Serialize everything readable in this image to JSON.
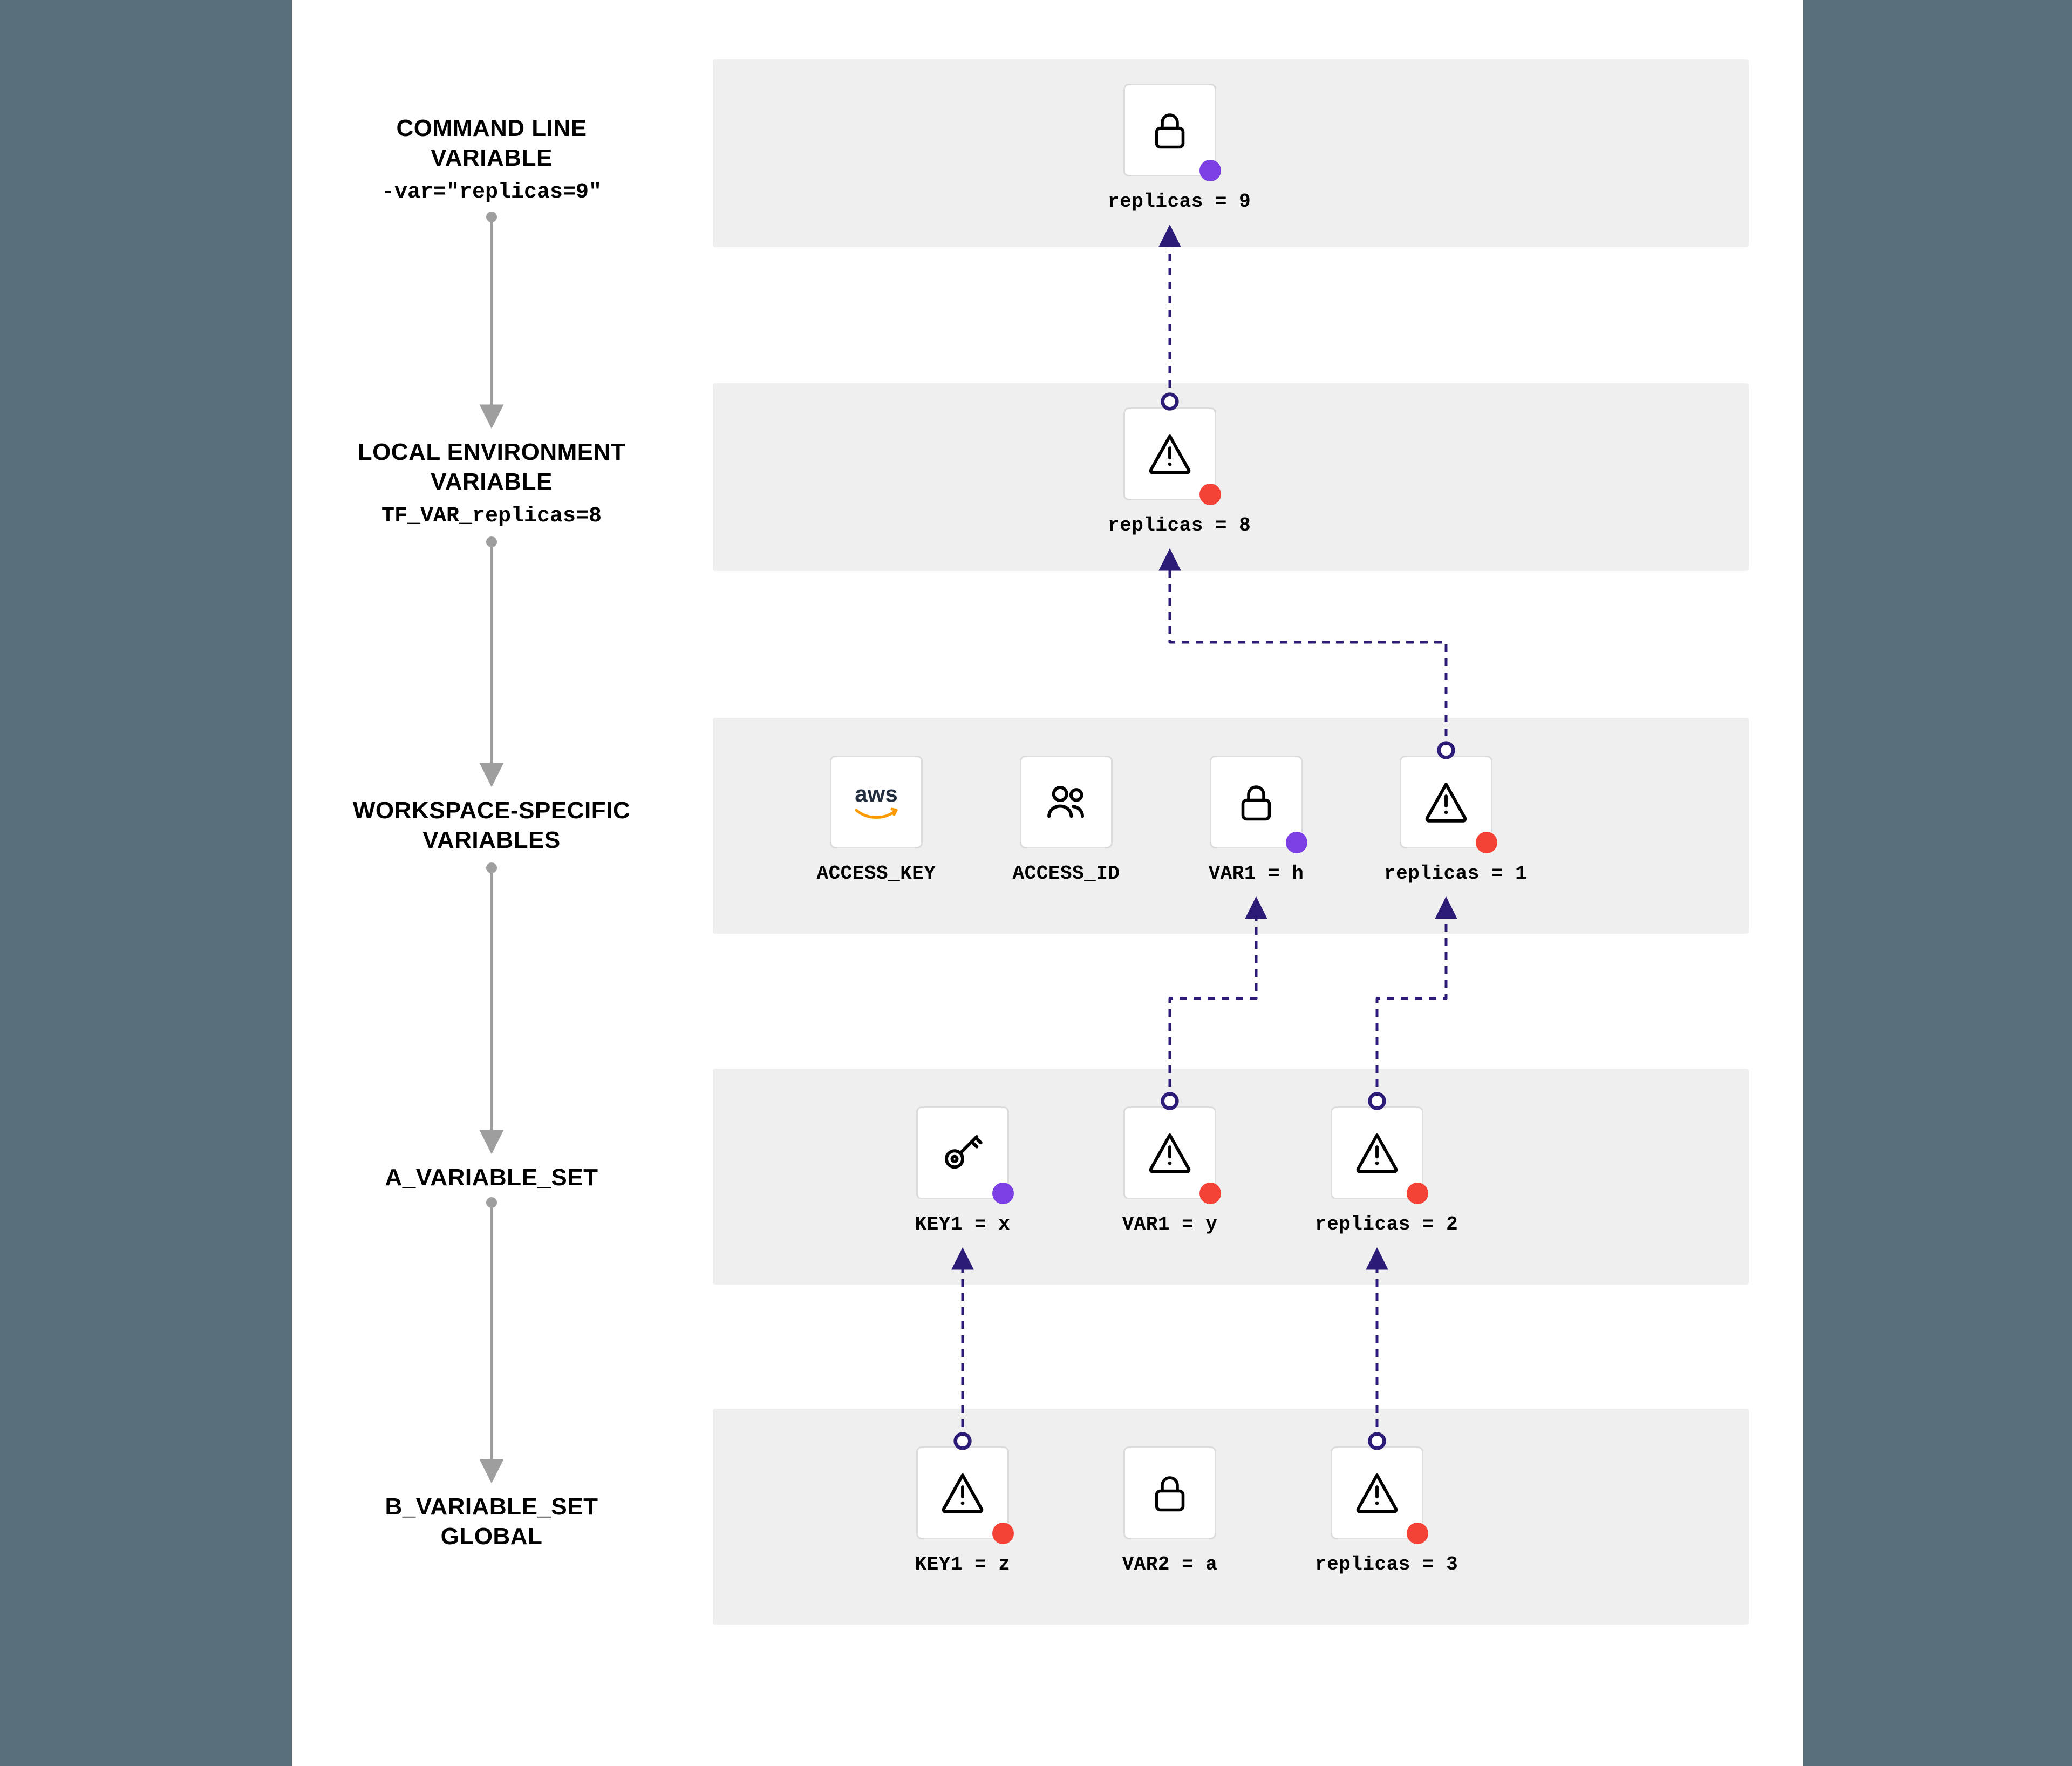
{
  "levels": [
    {
      "title_line1": "COMMAND LINE",
      "title_line2": "VARIABLE",
      "subtitle": "-var=\"replicas=9\""
    },
    {
      "title_line1": "LOCAL ENVIRONMENT",
      "title_line2": "VARIABLE",
      "subtitle": "TF_VAR_replicas=8"
    },
    {
      "title_line1": "WORKSPACE-SPECIFIC",
      "title_line2": "VARIABLES",
      "subtitle": ""
    },
    {
      "title_line1": "A_VARIABLE_SET",
      "title_line2": "",
      "subtitle": ""
    },
    {
      "title_line1": "B_VARIABLE_SET",
      "title_line2": "GLOBAL",
      "subtitle": ""
    }
  ],
  "row1": {
    "var": {
      "label": "replicas = 9",
      "icon": "lock",
      "dot": "purple"
    }
  },
  "row2": {
    "var": {
      "label": "replicas = 8",
      "icon": "warning",
      "dot": "red"
    }
  },
  "row3": {
    "v1": {
      "label": "ACCESS_KEY",
      "icon": "aws"
    },
    "v2": {
      "label": "ACCESS_ID",
      "icon": "users"
    },
    "v3": {
      "label": "VAR1 = h",
      "icon": "lock",
      "dot": "purple"
    },
    "v4": {
      "label": "replicas = 1",
      "icon": "warning",
      "dot": "red"
    }
  },
  "row4": {
    "v1": {
      "label": "KEY1 = x",
      "icon": "key",
      "dot": "purple"
    },
    "v2": {
      "label": "VAR1 = y",
      "icon": "warning",
      "dot": "red"
    },
    "v3": {
      "label": "replicas = 2",
      "icon": "warning",
      "dot": "red"
    }
  },
  "row5": {
    "v1": {
      "label": "KEY1 = z",
      "icon": "warning",
      "dot": "red"
    },
    "v2": {
      "label": "VAR2 = a",
      "icon": "lock"
    },
    "v3": {
      "label": "replicas = 3",
      "icon": "warning",
      "dot": "red"
    }
  },
  "colors": {
    "purple": "#7b3fe4",
    "red": "#f44336",
    "dashed": "#2e1b77",
    "gray_arrow": "#9e9e9e"
  }
}
